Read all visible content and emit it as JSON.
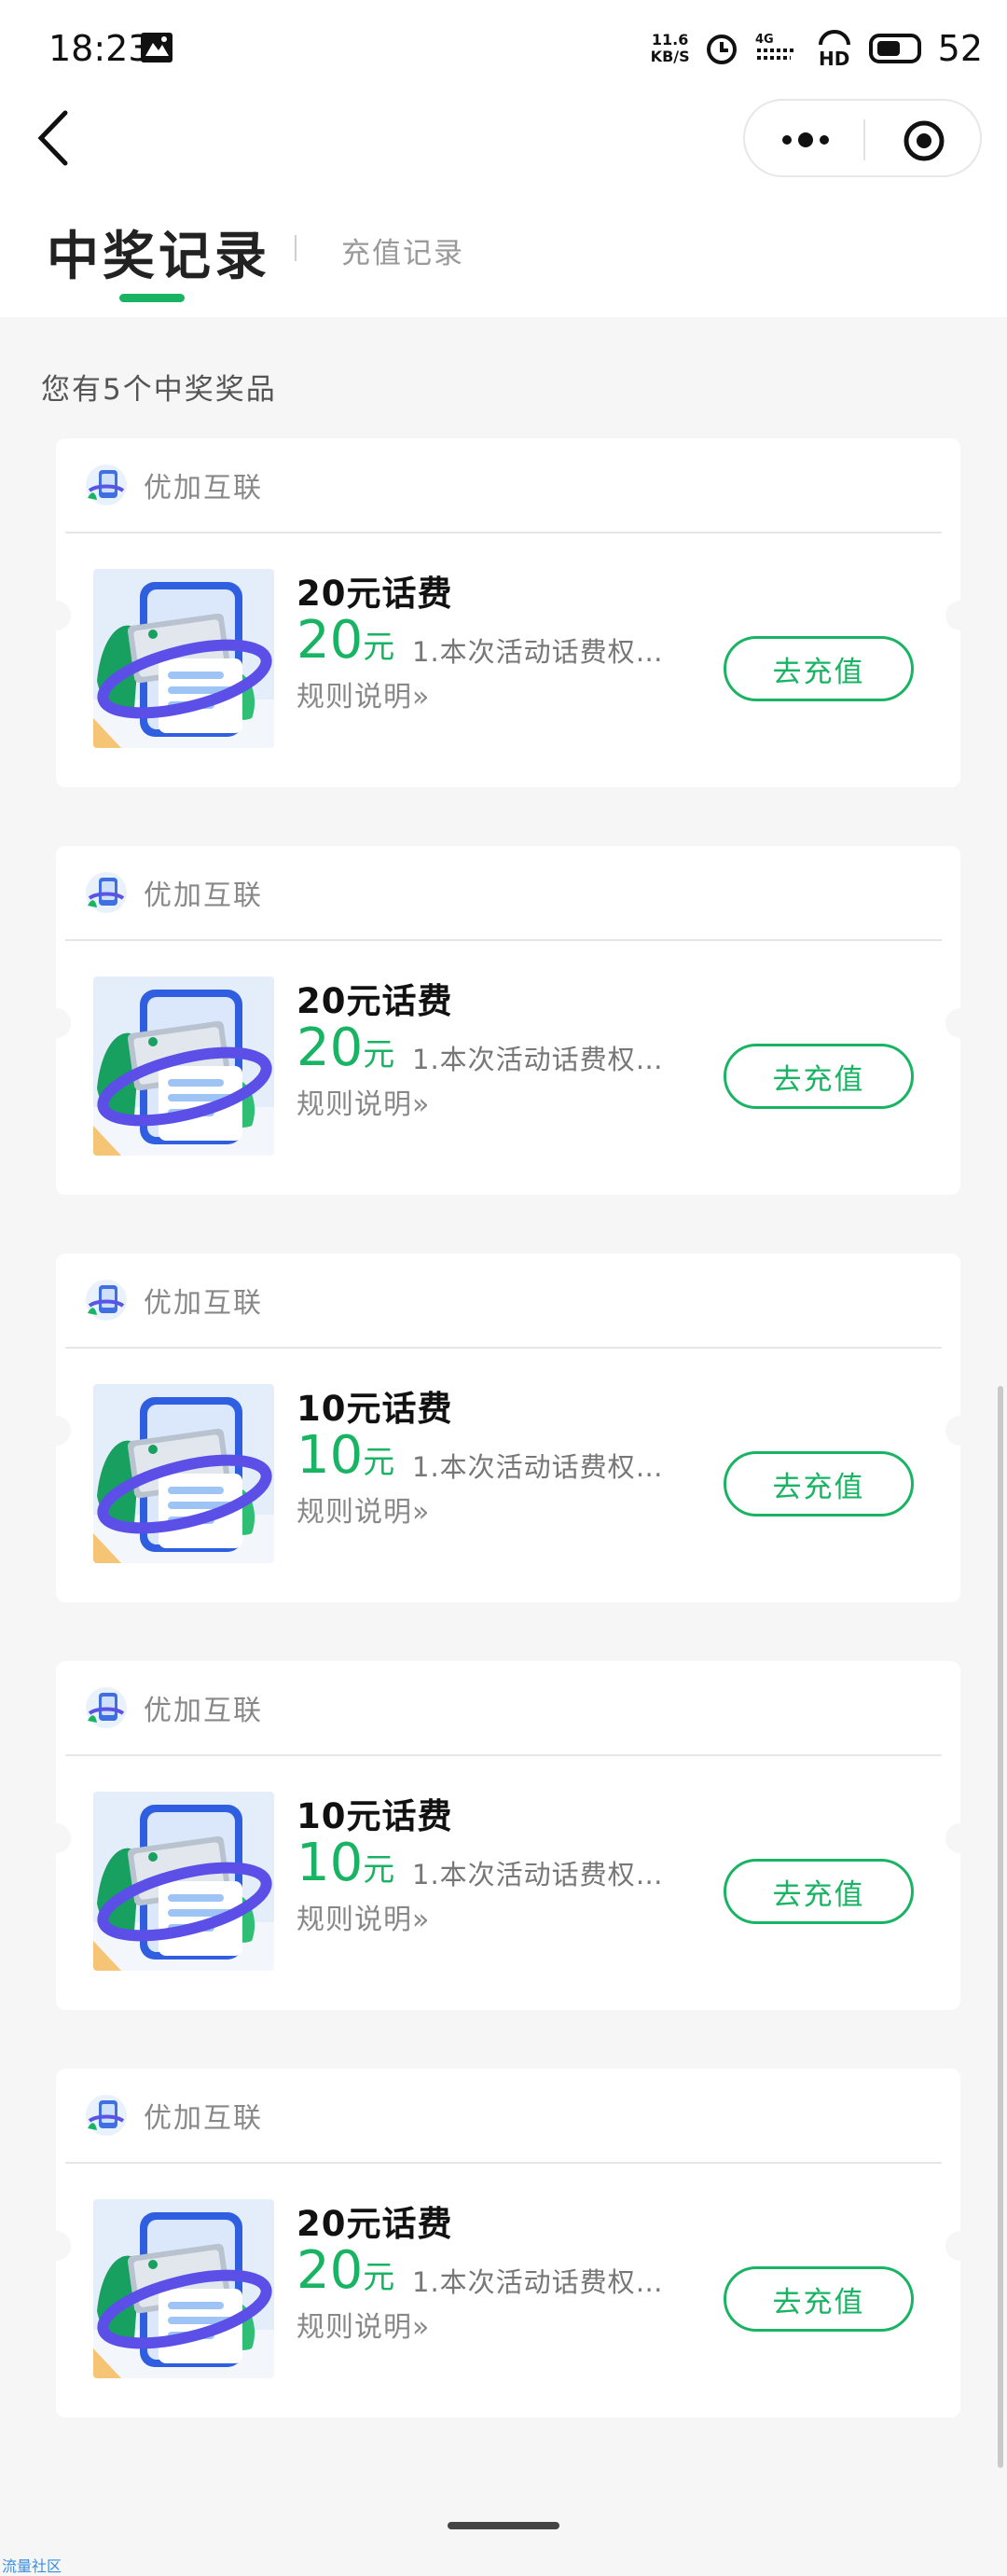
{
  "status_bar": {
    "time": "18:23",
    "net_speed_value": "11.6",
    "net_speed_unit": "KB/S",
    "network": "4G",
    "hd": "HD",
    "battery": "52"
  },
  "tabs": {
    "active": "中奖记录",
    "inactive": "充值记录"
  },
  "summary": "您有5个中奖奖品",
  "colors": {
    "accent": "#19b463"
  },
  "prizes": [
    {
      "merchant": "优加互联",
      "title": "20元话费",
      "amount": "20",
      "unit": "元",
      "desc": "1.本次活动话费权…",
      "rule": "规则说明»",
      "button": "去充值"
    },
    {
      "merchant": "优加互联",
      "title": "20元话费",
      "amount": "20",
      "unit": "元",
      "desc": "1.本次活动话费权…",
      "rule": "规则说明»",
      "button": "去充值"
    },
    {
      "merchant": "优加互联",
      "title": "10元话费",
      "amount": "10",
      "unit": "元",
      "desc": "1.本次活动话费权…",
      "rule": "规则说明»",
      "button": "去充值"
    },
    {
      "merchant": "优加互联",
      "title": "10元话费",
      "amount": "10",
      "unit": "元",
      "desc": "1.本次活动话费权…",
      "rule": "规则说明»",
      "button": "去充值"
    },
    {
      "merchant": "优加互联",
      "title": "20元话费",
      "amount": "20",
      "unit": "元",
      "desc": "1.本次活动话费权…",
      "rule": "规则说明»",
      "button": "去充值"
    }
  ],
  "watermark": "流量社区"
}
